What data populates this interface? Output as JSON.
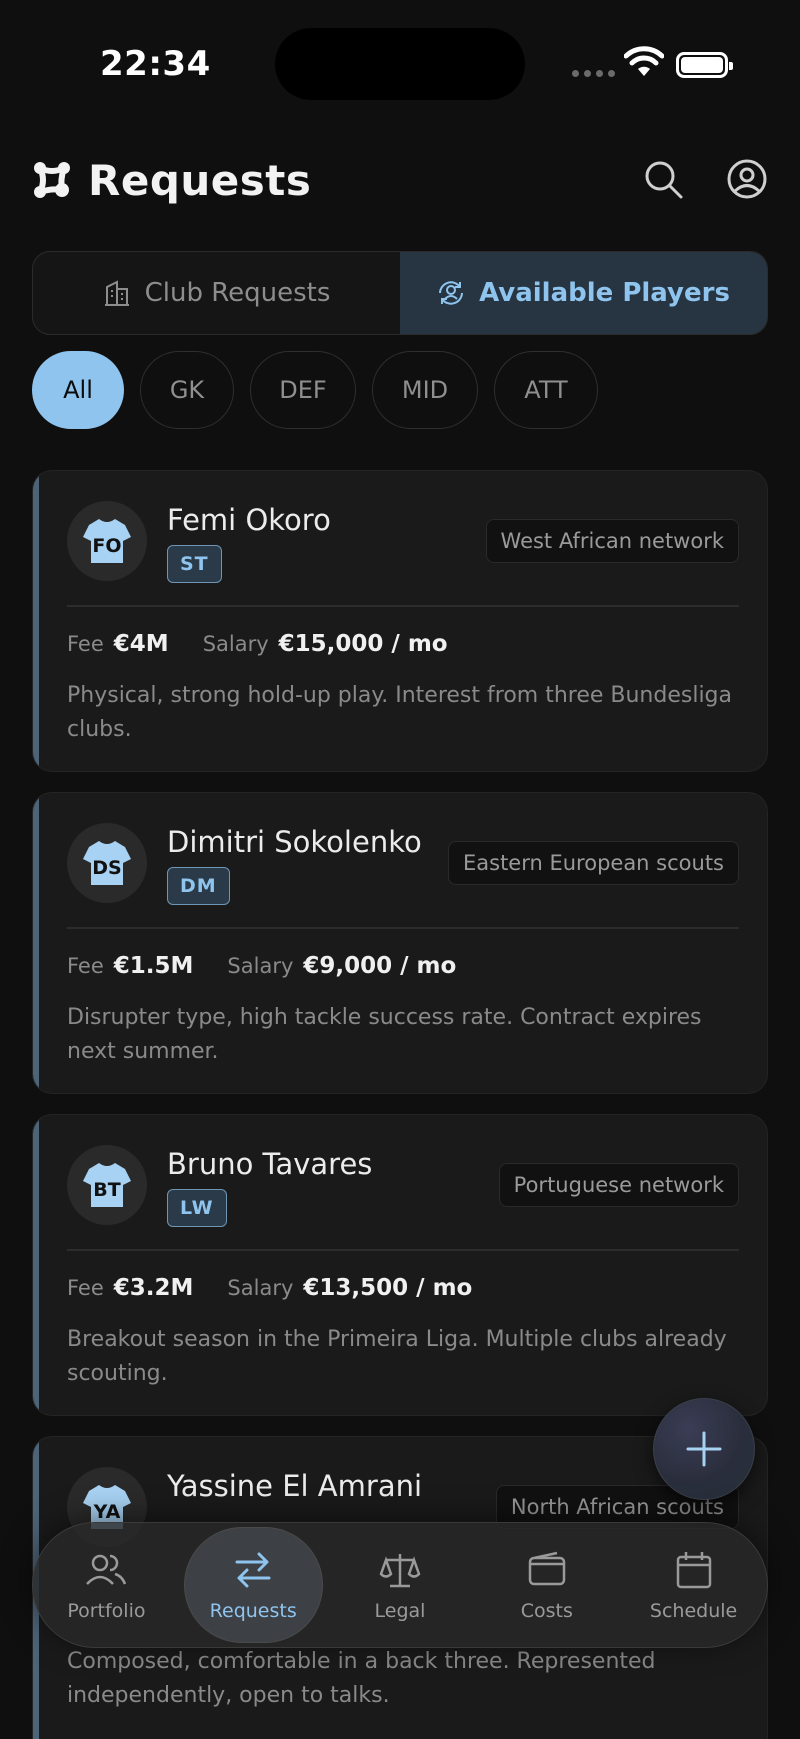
{
  "status": {
    "time": "22:34"
  },
  "header": {
    "title": "Requests"
  },
  "segments": [
    {
      "label": "Club Requests",
      "active": false
    },
    {
      "label": "Available Players",
      "active": true
    }
  ],
  "filters": [
    "All",
    "GK",
    "DEF",
    "MID",
    "ATT"
  ],
  "players": [
    {
      "initials": "FO",
      "name": "Femi Okoro",
      "position": "ST",
      "source": "West African network",
      "fee_label": "Fee",
      "fee": "€4M",
      "salary_label": "Salary",
      "salary": "€15,000 / mo",
      "note": "Physical, strong hold-up play. Interest from three Bundesliga clubs."
    },
    {
      "initials": "DS",
      "name": "Dimitri Sokolenko",
      "position": "DM",
      "source": "Eastern European scouts",
      "fee_label": "Fee",
      "fee": "€1.5M",
      "salary_label": "Salary",
      "salary": "€9,000 / mo",
      "note": "Disrupter type, high tackle success rate. Contract expires next summer."
    },
    {
      "initials": "BT",
      "name": "Bruno Tavares",
      "position": "LW",
      "source": "Portuguese network",
      "fee_label": "Fee",
      "fee": "€3.2M",
      "salary_label": "Salary",
      "salary": "€13,500 / mo",
      "note": "Breakout season in the Primeira Liga. Multiple clubs already scouting."
    },
    {
      "initials": "YA",
      "name": "Yassine El Amrani",
      "position": "",
      "source": "North African scouts",
      "note": "Composed, comfortable in a back three. Represented independently, open to talks."
    }
  ],
  "nav": [
    {
      "label": "Portfolio",
      "icon": "users-icon"
    },
    {
      "label": "Requests",
      "icon": "arrows-swap-icon"
    },
    {
      "label": "Legal",
      "icon": "scales-icon"
    },
    {
      "label": "Costs",
      "icon": "wallet-icon"
    },
    {
      "label": "Schedule",
      "icon": "calendar-icon"
    }
  ],
  "colors": {
    "accent": "#8fc4ee",
    "background": "#0f0f0f",
    "card": "#1a1a1a",
    "card_stripe": "#4c6378"
  }
}
